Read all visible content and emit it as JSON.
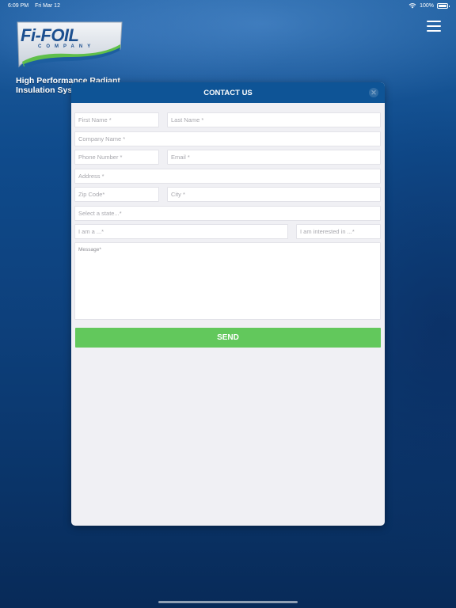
{
  "status_bar": {
    "time": "6:09 PM",
    "date": "Fri Mar 12",
    "battery": "100%",
    "icons": [
      "wifi-icon",
      "battery-icon"
    ]
  },
  "brand": {
    "logo_text": "Fi-FOIL",
    "logo_subtext": "COMPANY",
    "tagline_line1": "High Performance Radiant",
    "tagline_line2": "Insulation Sys"
  },
  "menu": {
    "icon": "hamburger-menu-icon"
  },
  "modal": {
    "title": "CONTACT US",
    "close_icon": "close-icon",
    "fields": {
      "first_name": "First Name *",
      "last_name": "Last Name *",
      "company_name": "Company Name *",
      "phone_number": "Phone Number *",
      "email": "Email *",
      "address": "Address *",
      "zip_code": "Zip Code*",
      "city": "City *",
      "state": "Select a state...*",
      "i_am_a": "I am a ...*",
      "interested_in": "I am interested in ...*",
      "message": "Message*"
    },
    "send_label": "SEND"
  },
  "colors": {
    "header": "#0e5496",
    "send": "#62c85c",
    "modal_bg": "#f0f0f4"
  }
}
